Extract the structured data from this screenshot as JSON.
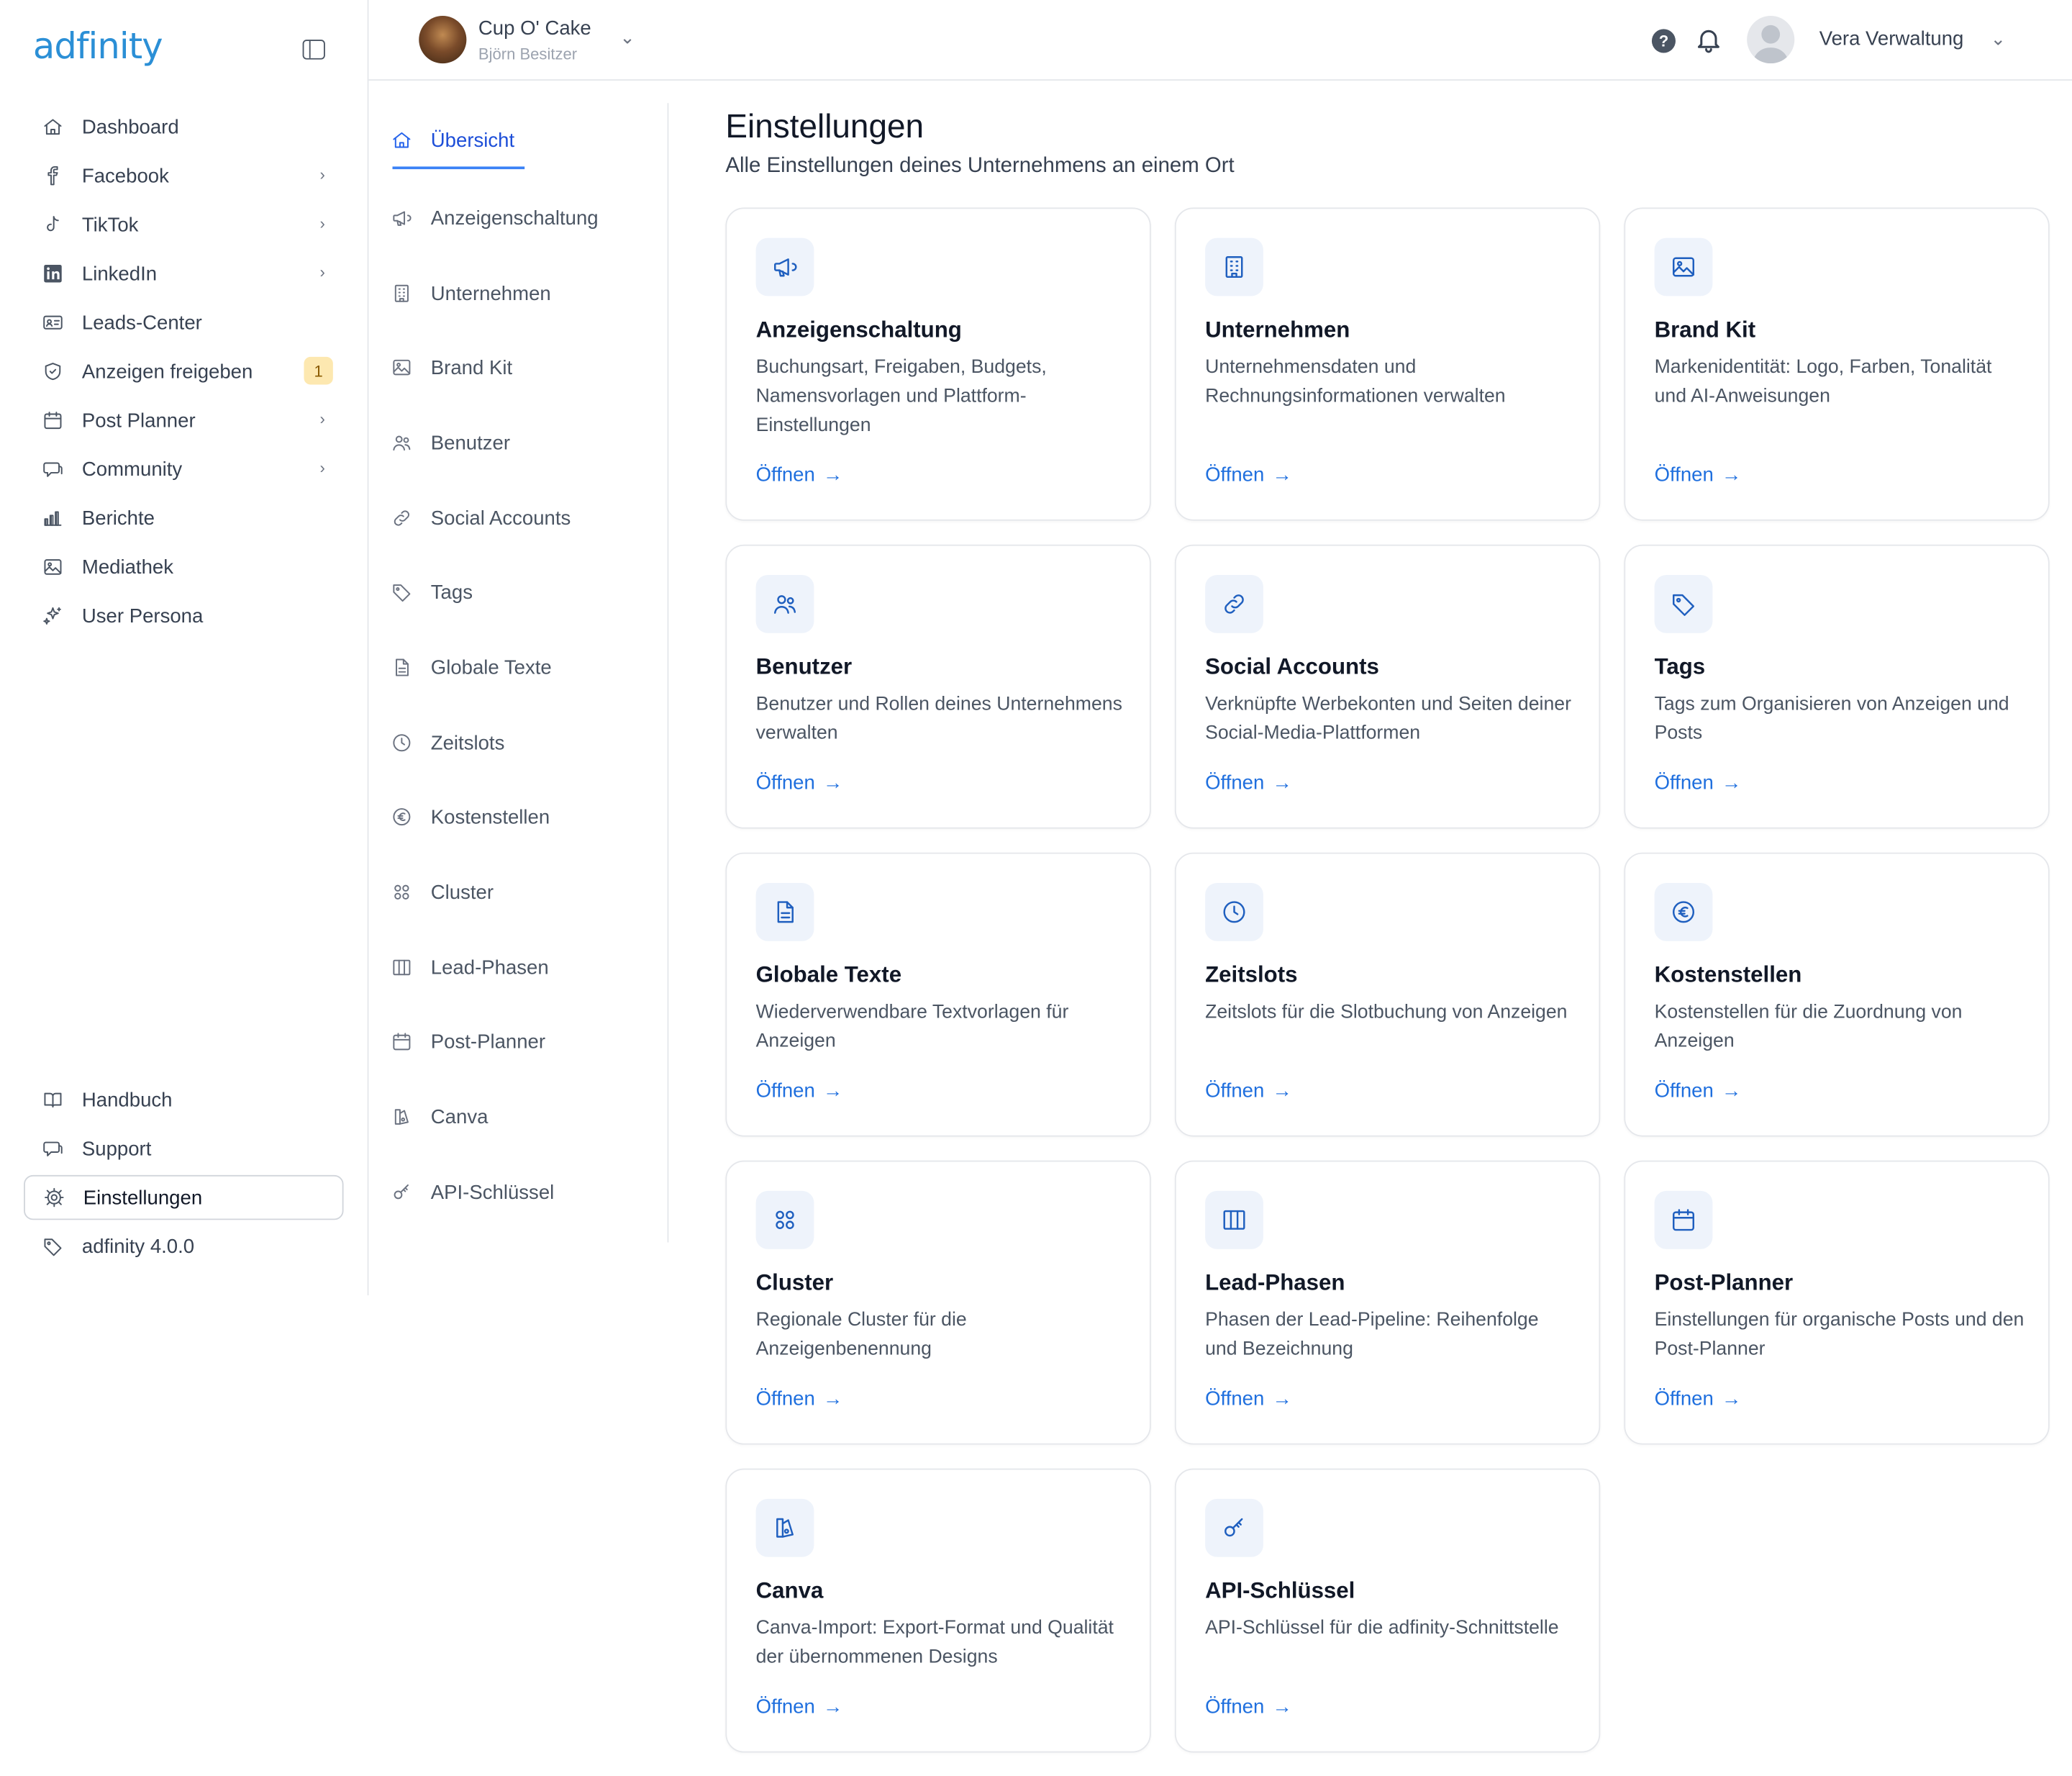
{
  "brand": {
    "logo_text": "adfinity"
  },
  "sidebar": {
    "items": [
      {
        "label": "Dashboard",
        "icon": "home-icon",
        "chevron": false
      },
      {
        "label": "Facebook",
        "icon": "facebook-icon",
        "chevron": true
      },
      {
        "label": "TikTok",
        "icon": "tiktok-icon",
        "chevron": true
      },
      {
        "label": "LinkedIn",
        "icon": "linkedin-icon",
        "chevron": true
      },
      {
        "label": "Leads-Center",
        "icon": "id-card-icon",
        "chevron": false
      },
      {
        "label": "Anzeigen freigeben",
        "icon": "shield-check-icon",
        "badge": "1"
      },
      {
        "label": "Post Planner",
        "icon": "calendar-icon",
        "chevron": true
      },
      {
        "label": "Community",
        "icon": "chat-icon",
        "chevron": true
      },
      {
        "label": "Berichte",
        "icon": "bar-chart-icon",
        "chevron": false
      },
      {
        "label": "Mediathek",
        "icon": "image-icon",
        "chevron": false
      },
      {
        "label": "User Persona",
        "icon": "sparkles-icon",
        "chevron": false
      }
    ],
    "bottom_items": [
      {
        "label": "Handbuch",
        "icon": "book-icon"
      },
      {
        "label": "Support",
        "icon": "chat-icon"
      },
      {
        "label": "Einstellungen",
        "icon": "gear-icon",
        "active": true
      },
      {
        "label": "adfinity 4.0.0",
        "icon": "tag-icon"
      }
    ]
  },
  "topbar": {
    "company_name": "Cup O' Cake",
    "company_owner": "Björn Besitzer",
    "help_label": "?",
    "user_name": "Vera Verwaltung"
  },
  "subnav": {
    "items": [
      {
        "label": "Übersicht",
        "icon": "home-icon",
        "active": true
      },
      {
        "label": "Anzeigenschaltung",
        "icon": "megaphone-icon"
      },
      {
        "label": "Unternehmen",
        "icon": "building-icon"
      },
      {
        "label": "Brand Kit",
        "icon": "image-icon"
      },
      {
        "label": "Benutzer",
        "icon": "users-icon"
      },
      {
        "label": "Social Accounts",
        "icon": "link-icon"
      },
      {
        "label": "Tags",
        "icon": "tag-icon"
      },
      {
        "label": "Globale Texte",
        "icon": "document-icon"
      },
      {
        "label": "Zeitslots",
        "icon": "clock-icon"
      },
      {
        "label": "Kostenstellen",
        "icon": "euro-icon"
      },
      {
        "label": "Cluster",
        "icon": "grid-icon"
      },
      {
        "label": "Lead-Phasen",
        "icon": "columns-icon"
      },
      {
        "label": "Post-Planner",
        "icon": "calendar-icon"
      },
      {
        "label": "Canva",
        "icon": "canva-icon"
      },
      {
        "label": "API-Schlüssel",
        "icon": "key-icon"
      }
    ]
  },
  "main": {
    "title": "Einstellungen",
    "subtitle": "Alle Einstellungen deines Unternehmens an einem Ort",
    "open_label": "Öffnen",
    "cards": [
      {
        "title": "Anzeigenschaltung",
        "description": "Buchungsart, Freigaben, Budgets, Namensvorlagen und Plattform-Einstellungen",
        "icon": "megaphone-icon"
      },
      {
        "title": "Unternehmen",
        "description": "Unternehmensdaten und Rechnungsinformationen verwalten",
        "icon": "building-icon"
      },
      {
        "title": "Brand Kit",
        "description": "Markenidentität: Logo, Farben, Tonalität und AI-Anweisungen",
        "icon": "image-icon"
      },
      {
        "title": "Benutzer",
        "description": "Benutzer und Rollen deines Unternehmens verwalten",
        "icon": "users-icon"
      },
      {
        "title": "Social Accounts",
        "description": "Verknüpfte Werbekonten und Seiten deiner Social-Media-Plattformen",
        "icon": "link-icon"
      },
      {
        "title": "Tags",
        "description": "Tags zum Organisieren von Anzeigen und Posts",
        "icon": "tag-icon"
      },
      {
        "title": "Globale Texte",
        "description": "Wiederverwendbare Textvorlagen für Anzeigen",
        "icon": "document-icon"
      },
      {
        "title": "Zeitslots",
        "description": "Zeitslots für die Slotbuchung von Anzeigen",
        "icon": "clock-icon"
      },
      {
        "title": "Kostenstellen",
        "description": "Kostenstellen für die Zuordnung von Anzeigen",
        "icon": "euro-icon"
      },
      {
        "title": "Cluster",
        "description": "Regionale Cluster für die Anzeigenbenennung",
        "icon": "grid-icon"
      },
      {
        "title": "Lead-Phasen",
        "description": "Phasen der Lead-Pipeline: Reihenfolge und Bezeichnung",
        "icon": "columns-icon"
      },
      {
        "title": "Post-Planner",
        "description": "Einstellungen für organische Posts und den Post-Planner",
        "icon": "calendar-icon"
      },
      {
        "title": "Canva",
        "description": "Canva-Import: Export-Format und Qualität der übernommenen Designs",
        "icon": "canva-icon"
      },
      {
        "title": "API-Schlüssel",
        "description": "API-Schlüssel für die adfinity-Schnittstelle",
        "icon": "key-icon"
      }
    ]
  },
  "colors": {
    "accent": "#1f6fde",
    "card_icon_bg": "#eef3fb",
    "badge_bg": "#fde8b0"
  }
}
